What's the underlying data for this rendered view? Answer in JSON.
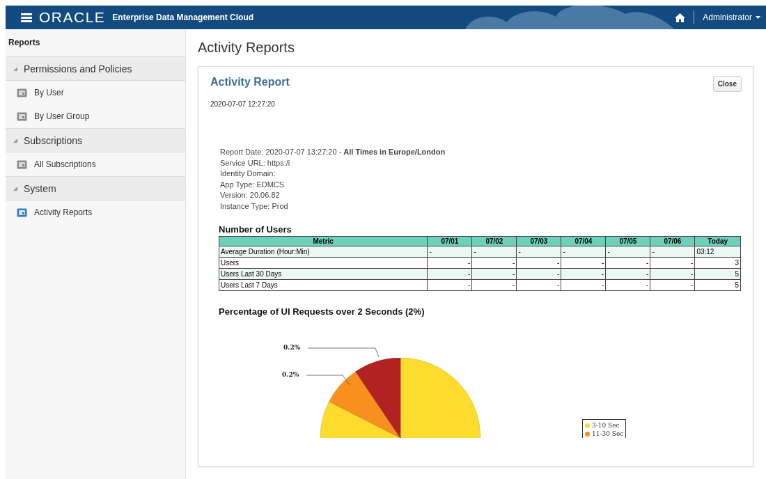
{
  "header": {
    "brand": "ORACLE",
    "product": "Enterprise Data Management Cloud",
    "user": "Administrator"
  },
  "sidebar": {
    "title": "Reports",
    "sections": [
      {
        "label": "Permissions and Policies",
        "expanded": true,
        "children": [
          {
            "label": "By User",
            "selected": false
          },
          {
            "label": "By User Group",
            "selected": false
          }
        ]
      },
      {
        "label": "Subscriptions",
        "expanded": true,
        "children": [
          {
            "label": "All Subscriptions",
            "selected": false
          }
        ]
      },
      {
        "label": "System",
        "expanded": true,
        "children": [
          {
            "label": "Activity Reports",
            "selected": true
          }
        ]
      }
    ]
  },
  "page_title": "Activity Reports",
  "report": {
    "title": "Activity Report",
    "timestamp": "2020-07-07 12:27:20",
    "close_button": "Close",
    "details": [
      "Report Date: 2020-07-07 13:27:20 - **All Times in Europe/London**",
      "Service URL:  https:/i",
      "Identity Domain:",
      "App Type:  EDMCS",
      "Version: 20.06.82",
      "Instance Type: Prod"
    ],
    "table": {
      "title": "Number of Users",
      "columns": [
        "Metric",
        "07/01",
        "07/02",
        "07/03",
        "07/04",
        "07/05",
        "07/06",
        "Today"
      ],
      "rows": [
        {
          "kind": "duration",
          "cells": [
            "Average Duration (Hour:Min)",
            "-",
            "-",
            "-",
            "-",
            "-",
            "-",
            "03:12"
          ]
        },
        {
          "kind": "count",
          "cells": [
            "Users",
            "-",
            "-",
            "-",
            "-",
            "-",
            "-",
            "3"
          ]
        },
        {
          "kind": "count",
          "cells": [
            "Users Last 30 Days",
            "-",
            "-",
            "-",
            "-",
            "-",
            "-",
            "5"
          ]
        },
        {
          "kind": "count",
          "cells": [
            "Users Last 7 Days",
            "-",
            "-",
            "-",
            "-",
            "-",
            "-",
            "5"
          ]
        }
      ]
    },
    "pie": {
      "title": "Percentage of UI Requests over 2 Seconds (2%)",
      "slice_labels": [
        "0.2%",
        "0.2%"
      ],
      "legend": [
        {
          "label": "3-10 Sec",
          "color": "#fddc2e"
        },
        {
          "label": "11-30 Sec",
          "color": "#f7901e"
        }
      ]
    }
  }
}
